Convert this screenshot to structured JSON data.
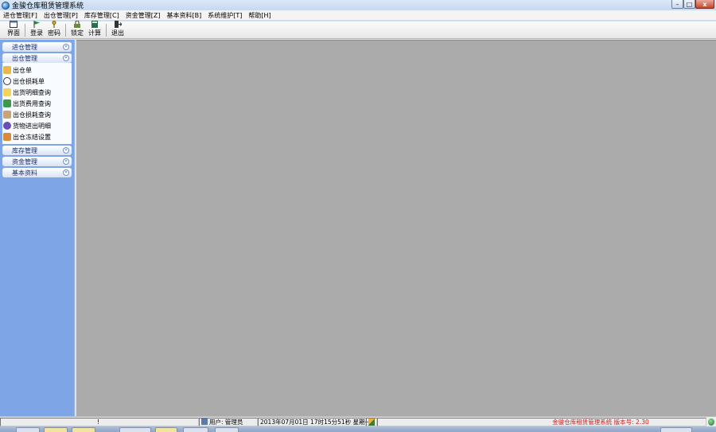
{
  "window": {
    "title": "金骏仓库租赁管理系统",
    "buttons": {
      "minimize": "–",
      "maximize": "□",
      "close": "x"
    }
  },
  "menu": [
    "进仓管理[F]",
    "出仓管理[P]",
    "库存管理[C]",
    "资金管理[Z]",
    "基本资料[B]",
    "系统维护[T]",
    "帮助[H]"
  ],
  "toolbar": {
    "interface": "界面",
    "login": "登录",
    "password": "密码",
    "lock": "锁定",
    "calc": "计算",
    "exit": "退出"
  },
  "sidebar": {
    "groups": [
      {
        "label": "进仓管理",
        "chevron": "»"
      },
      {
        "label": "出仓管理",
        "chevron": "«"
      },
      {
        "label": "库存管理",
        "chevron": "»"
      },
      {
        "label": "资金管理",
        "chevron": "»"
      },
      {
        "label": "基本资料",
        "chevron": "»"
      }
    ],
    "items": [
      "出仓单",
      "出仓损耗单",
      "出货明细查询",
      "出货费用查询",
      "出仓损耗查询",
      "货物进出明细",
      "出仓冻结设置"
    ]
  },
  "status": {
    "indicator": "!",
    "user": "用户: 管理员",
    "datetime": "2013年07月01日  17时15分51秒  星期一",
    "app_version": "金骏仓库租赁管理系统  版本号: 2.30"
  }
}
